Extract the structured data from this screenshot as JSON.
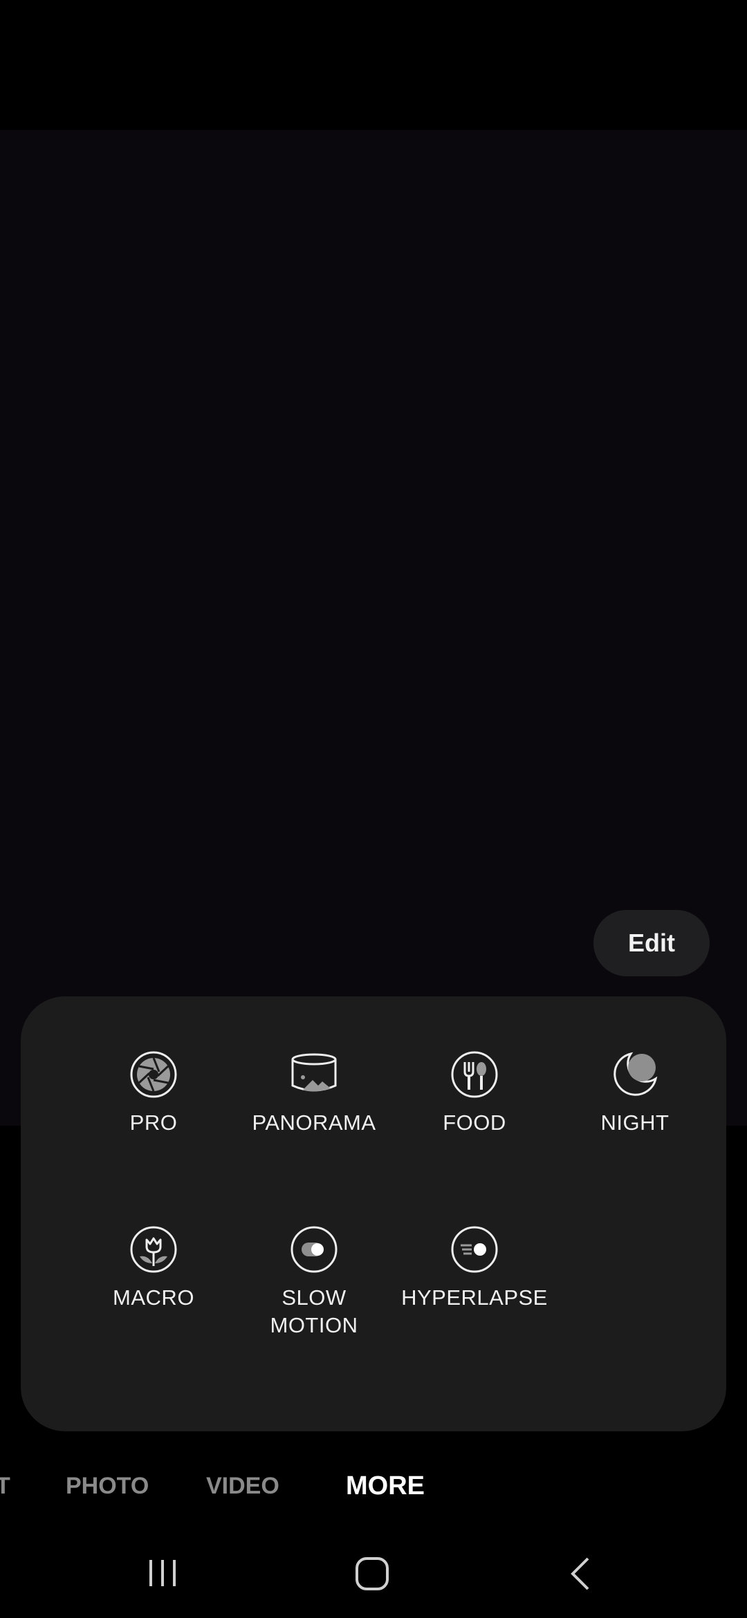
{
  "edit_label": "Edit",
  "modes": [
    {
      "label": "PRO",
      "icon": "aperture-icon"
    },
    {
      "label": "PANORAMA",
      "icon": "panorama-icon"
    },
    {
      "label": "FOOD",
      "icon": "food-icon"
    },
    {
      "label": "NIGHT",
      "icon": "moon-icon"
    },
    {
      "label": "MACRO",
      "icon": "flower-icon"
    },
    {
      "label": "SLOW\nMOTION",
      "icon": "slow-motion-icon"
    },
    {
      "label": "HYPERLAPSE",
      "icon": "hyperlapse-icon"
    }
  ],
  "mode_bar": {
    "partial_tab": "T",
    "photo": "PHOTO",
    "video": "VIDEO",
    "more": "MORE"
  },
  "colors": {
    "viewfinder": "#0a080d",
    "panel": "#1c1c1d",
    "edit_bg": "#1f1f21",
    "inactive_tab": "#8a8a8a"
  }
}
